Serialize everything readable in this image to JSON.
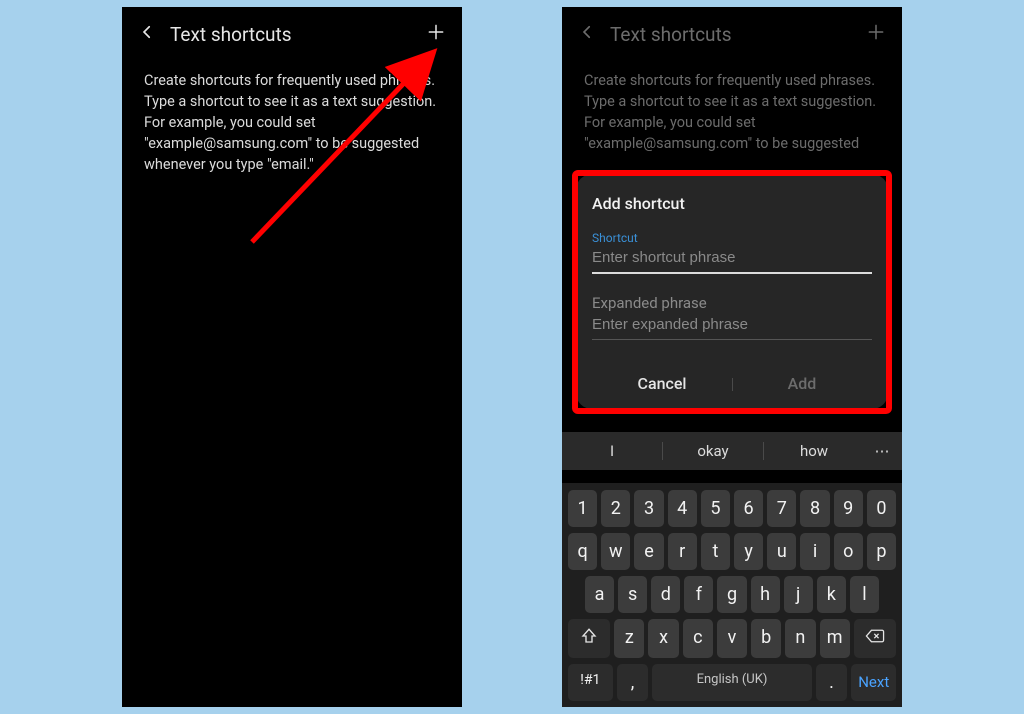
{
  "header": {
    "title": "Text shortcuts",
    "description": "Create shortcuts for frequently used phrases. Type a shortcut to see it as a text suggestion. For example, you could set \"example@samsung.com\" to be suggested whenever you type \"email.\""
  },
  "header2": {
    "title": "Text shortcuts",
    "description_truncated": "Create shortcuts for frequently used phrases. Type a shortcut to see it as a text suggestion. For example, you could set \"example@samsung.com\" to be suggested"
  },
  "dialog": {
    "title": "Add shortcut",
    "shortcut_label": "Shortcut",
    "shortcut_placeholder": "Enter shortcut phrase",
    "expanded_label": "Expanded phrase",
    "expanded_placeholder": "Enter expanded phrase",
    "cancel": "Cancel",
    "add": "Add"
  },
  "suggestions": {
    "w1": "I",
    "w2": "okay",
    "w3": "how"
  },
  "kbd": {
    "row1": [
      "1",
      "2",
      "3",
      "4",
      "5",
      "6",
      "7",
      "8",
      "9",
      "0"
    ],
    "row2": [
      "q",
      "w",
      "e",
      "r",
      "t",
      "y",
      "u",
      "i",
      "o",
      "p"
    ],
    "row3": [
      "a",
      "s",
      "d",
      "f",
      "g",
      "h",
      "j",
      "k",
      "l"
    ],
    "row4": [
      "z",
      "x",
      "c",
      "v",
      "b",
      "n",
      "m"
    ],
    "sym": "!#1",
    "comma": ",",
    "space": "English (UK)",
    "period": ".",
    "next": "Next"
  }
}
